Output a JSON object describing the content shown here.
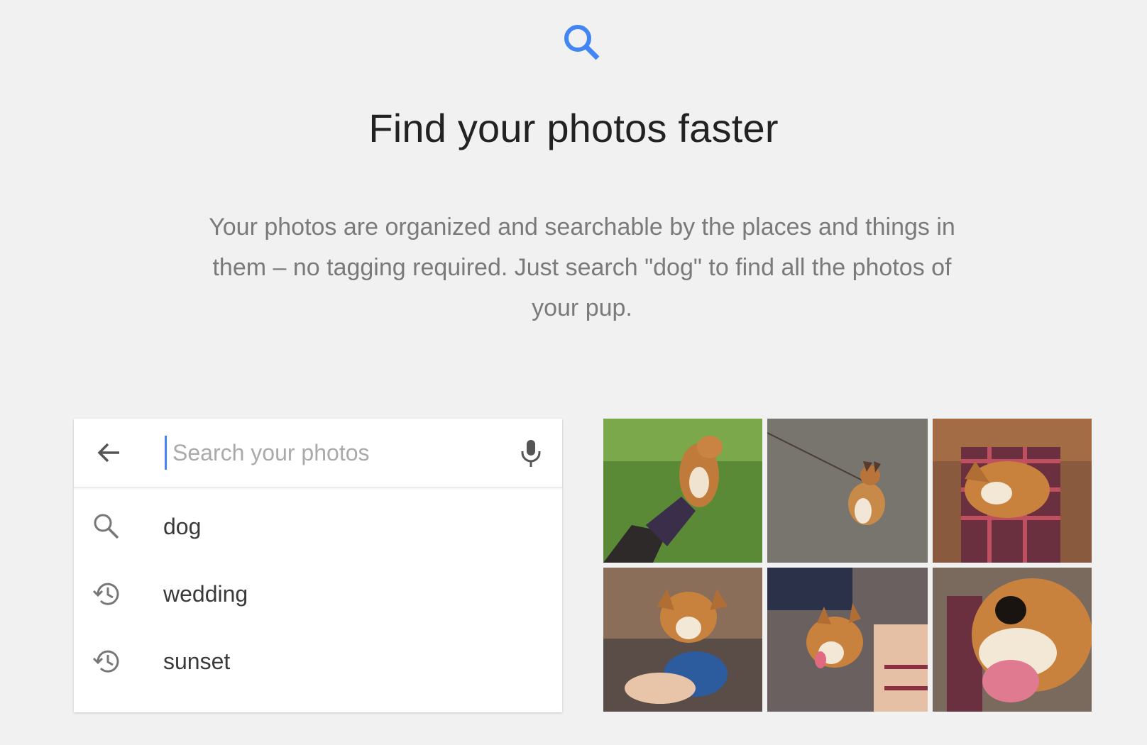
{
  "hero": {
    "icon": "search-icon",
    "title": "Find your photos faster",
    "description": "Your photos are organized and searchable by the places and things in them – no tagging required. Just search \"dog\" to find all the photos of your pup."
  },
  "search": {
    "placeholder": "Search your photos",
    "value": "",
    "back_icon": "arrow-left-icon",
    "mic_icon": "microphone-icon",
    "suggestions": [
      {
        "label": "dog",
        "icon": "search-icon"
      },
      {
        "label": "wedding",
        "icon": "history-icon"
      },
      {
        "label": "sunset",
        "icon": "history-icon"
      }
    ]
  },
  "photos": [
    {
      "subject": "corgi jumping on grass"
    },
    {
      "subject": "corgi on leash on pavement"
    },
    {
      "subject": "person holding corgi"
    },
    {
      "subject": "corgi with blue toy"
    },
    {
      "subject": "smiling corgi being petted"
    },
    {
      "subject": "corgi close-up with tongue out"
    }
  ],
  "colors": {
    "accent": "#4285f4",
    "background": "#f1f1f1",
    "card": "#ffffff"
  }
}
